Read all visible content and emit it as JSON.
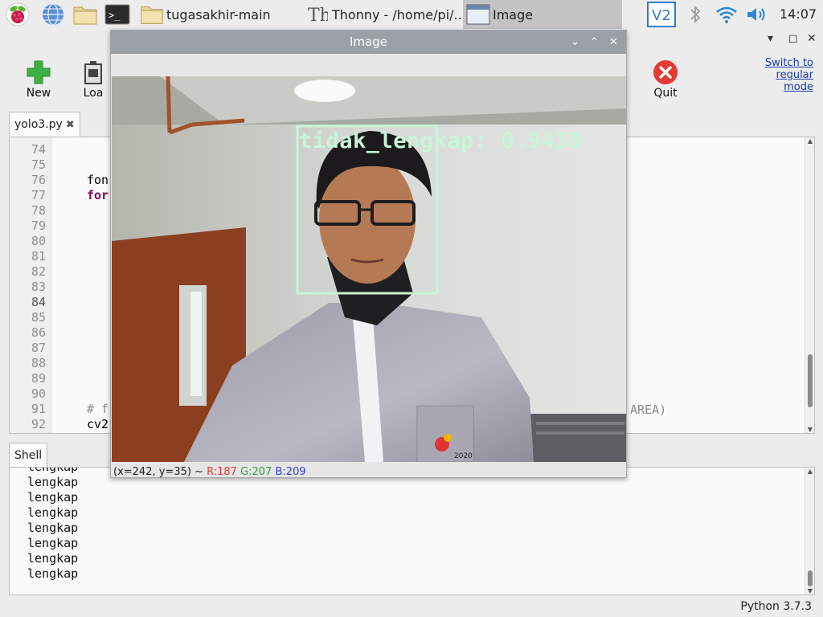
{
  "taskbar": {
    "tasks": [
      {
        "label": "tugasakhir-main"
      },
      {
        "label": "Thonny  -  /home/pi/..."
      },
      {
        "label": "Image"
      }
    ],
    "clock": "14:07"
  },
  "thonny": {
    "toolbar": {
      "new_label": "New",
      "load_label": "Loa",
      "quit_label": "Quit",
      "switch_link": [
        "Switch to",
        "regular",
        "mode"
      ]
    },
    "editor": {
      "tab_label": "yolo3.py",
      "line_numbers": [
        "74",
        "75",
        "76",
        "77",
        "78",
        "79",
        "80",
        "81",
        "82",
        "83",
        "84",
        "85",
        "86",
        "87",
        "88",
        "89",
        "90",
        "91",
        "92"
      ],
      "current_line": "84",
      "code": [
        {
          "line": "76",
          "text": "fon",
          "kind": "plain"
        },
        {
          "line": "77",
          "text": "for",
          "kind": "kw"
        },
        {
          "line": "91",
          "text": "# f",
          "kind": "comment"
        },
        {
          "line": "92",
          "text": "cv2",
          "kind": "plain"
        }
      ],
      "right_fragment": "AREA)"
    },
    "shell": {
      "tab_label": "Shell",
      "lines": [
        "lengkap",
        "lengkap",
        "lengkap",
        "lengkap",
        "lengkap",
        "lengkap",
        "lengkap",
        "lengkap"
      ]
    },
    "status": "Python 3.7.3"
  },
  "image_window": {
    "title": "Image",
    "detection": {
      "label": "tidak_lengkap: 0.9438",
      "color": "#c8f5d8"
    },
    "readout": {
      "coords": "(x=242, y=35) ~",
      "r": "R:187",
      "g": "G:207",
      "b": "B:209"
    },
    "badge_text": "2020"
  },
  "colors": {
    "accent_link": "#1a3cbf",
    "new_icon": "#3cb043",
    "quit_icon": "#e53935",
    "title_bar": "#9aa0a6"
  }
}
